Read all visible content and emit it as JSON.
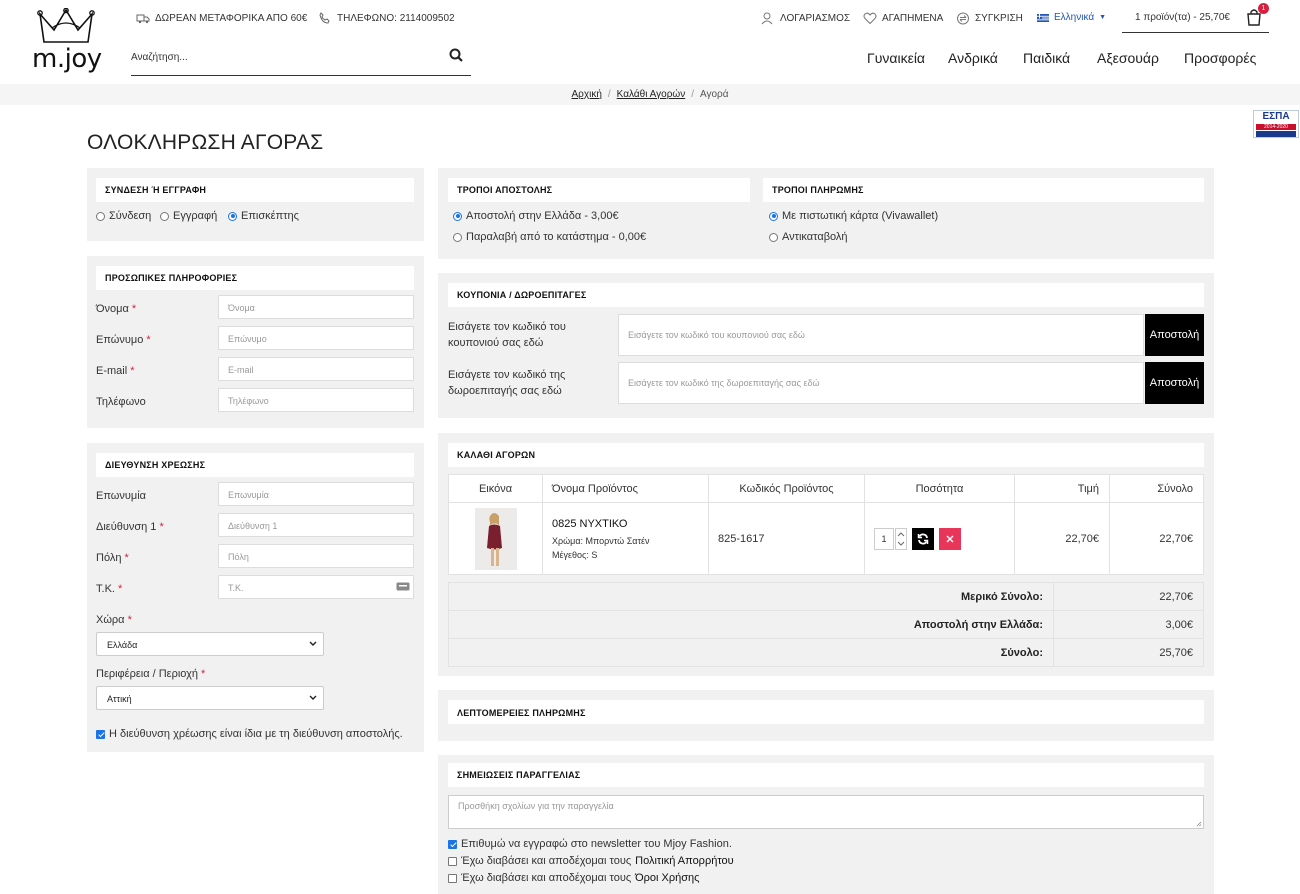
{
  "header": {
    "logo_text": "m.joy",
    "free_shipping": "ΔΩΡΕΑΝ ΜΕΤΑΦΟΡΙΚΑ ΑΠΟ 60€",
    "phone": "ΤΗΛΕΦΩΝΟ: 2114009502",
    "search_placeholder": "Αναζήτηση...",
    "account": "ΛΟΓΑΡΙΑΣΜΟΣ",
    "favorites": "ΑΓΑΠΗΜΕΝΑ",
    "compare": "ΣΥΓΚΡΙΣΗ",
    "language": "Ελληνικά",
    "cart_summary": "1 προϊόν(τα) - 25,70€",
    "cart_count": "1",
    "nav": [
      "Γυναικεία",
      "Ανδρικά",
      "Παιδικά",
      "Αξεσουάρ",
      "Προσφορές"
    ]
  },
  "breadcrumb": [
    "Αρχική",
    "Καλάθι Αγορών",
    "Αγορά"
  ],
  "espa": {
    "top": "ΕΣΠΑ",
    "bar": "2014-2020"
  },
  "page_title": "ΟΛΟΚΛΗΡΩΣΗ ΑΓΟΡΑΣ",
  "login": {
    "title": "ΣΥΝΔΕΣΗ Ή ΕΓΓΡΑΦΗ",
    "options": [
      "Σύνδεση",
      "Εγγραφή",
      "Επισκέπτης"
    ],
    "selected": 2
  },
  "personal": {
    "title": "ΠΡΟΣΩΠΙΚΕΣ ΠΛΗΡΟΦΟΡΙΕΣ",
    "fields": [
      {
        "label": "Όνομα",
        "placeholder": "Όνομα",
        "required": "*"
      },
      {
        "label": "Επώνυμο",
        "placeholder": "Επώνυμο",
        "required": "*"
      },
      {
        "label": "E-mail",
        "placeholder": "E-mail",
        "required": "*"
      },
      {
        "label": "Τηλέφωνο",
        "placeholder": "Τηλέφωνο",
        "required": ""
      }
    ]
  },
  "billing": {
    "title": "ΔΙΕΥΘΥΝΣΗ ΧΡΕΩΣΗΣ",
    "fields": [
      {
        "label": "Επωνυμία",
        "placeholder": "Επωνυμία",
        "required": ""
      },
      {
        "label": "Διεύθυνση 1",
        "placeholder": "Διεύθυνση 1",
        "required": "*"
      },
      {
        "label": "Πόλη",
        "placeholder": "Πόλη",
        "required": "*"
      },
      {
        "label": "Τ.Κ.",
        "placeholder": "Τ.Κ.",
        "required": "*"
      }
    ],
    "country_label": "Χώρα",
    "country_value": "Ελλάδα",
    "region_label": "Περιφέρεια / Περιοχή",
    "region_value": "Αττική",
    "same_address": "Η διεύθυνση χρέωσης είναι ίδια με τη διεύθυνση αποστολής."
  },
  "shipping": {
    "title": "ΤΡΟΠΟΙ ΑΠΟΣΤΟΛΗΣ",
    "options": [
      "Αποστολή στην Ελλάδα - 3,00€",
      "Παραλαβή από το κατάστημα - 0,00€"
    ],
    "selected": 0
  },
  "payment": {
    "title": "ΤΡΟΠΟΙ ΠΛΗΡΩΜΗΣ",
    "options": [
      "Με πιστωτική κάρτα (Vivawallet)",
      "Αντικαταβολή"
    ],
    "selected": 0
  },
  "coupons": {
    "title": "ΚΟΥΠΟΝΙΑ / ΔΩΡΟΕΠΙΤΑΓΕΣ",
    "coupon_label": "Εισάγετε τον κωδικό του κουπονιού σας εδώ",
    "coupon_placeholder": "Εισάγετε τον κωδικό του κουπονιού σας εδώ",
    "voucher_label": "Εισάγετε τον κωδικό της δωροεπιταγής σας εδώ",
    "voucher_placeholder": "Εισάγετε τον κωδικό της δωροεπιταγής σας εδώ",
    "submit": "Αποστολή"
  },
  "cart": {
    "title": "ΚΑΛΑΘΙ ΑΓΟΡΩΝ",
    "columns": [
      "Εικόνα",
      "Όνομα Προϊόντος",
      "Κωδικός Προϊόντος",
      "Ποσότητα",
      "Τιμή",
      "Σύνολο"
    ],
    "item": {
      "name": "0825 ΝΥΧΤΙΚΟ",
      "color": "Χρώμα: Μπορντώ Σατέν",
      "size": "Μέγεθος: S",
      "code": "825-1617",
      "qty": "1",
      "price": "22,70€",
      "total": "22,70€"
    },
    "totals": [
      {
        "label": "Μερικό Σύνολο:",
        "value": "22,70€"
      },
      {
        "label": "Αποστολή στην Ελλάδα:",
        "value": "3,00€"
      },
      {
        "label": "Σύνολο:",
        "value": "25,70€"
      }
    ]
  },
  "payment_details": {
    "title": "ΛΕΠΤΟΜΕΡΕΙΕΣ ΠΛΗΡΩΜΗΣ"
  },
  "notes": {
    "title": "ΣΗΜΕΙΩΣΕΙΣ ΠΑΡΑΓΓΕΛΙΑΣ",
    "placeholder": "Προσθήκη σχολίων για την παραγγελία",
    "newsletter": "Επιθυμώ να εγγραφώ στο newsletter του Mjoy Fashion.",
    "privacy_prefix": "Έχω διαβάσει και αποδέχομαι τους",
    "privacy_link": "Πολιτική Απορρήτου",
    "terms_prefix": "Έχω διαβάσει και αποδέχομαι τους",
    "terms_link": "Όροι Χρήσης"
  },
  "colors": {
    "accent": "#1a73e8",
    "danger": "#d6203f",
    "panel": "#f1f1f1",
    "button": "#000000"
  }
}
